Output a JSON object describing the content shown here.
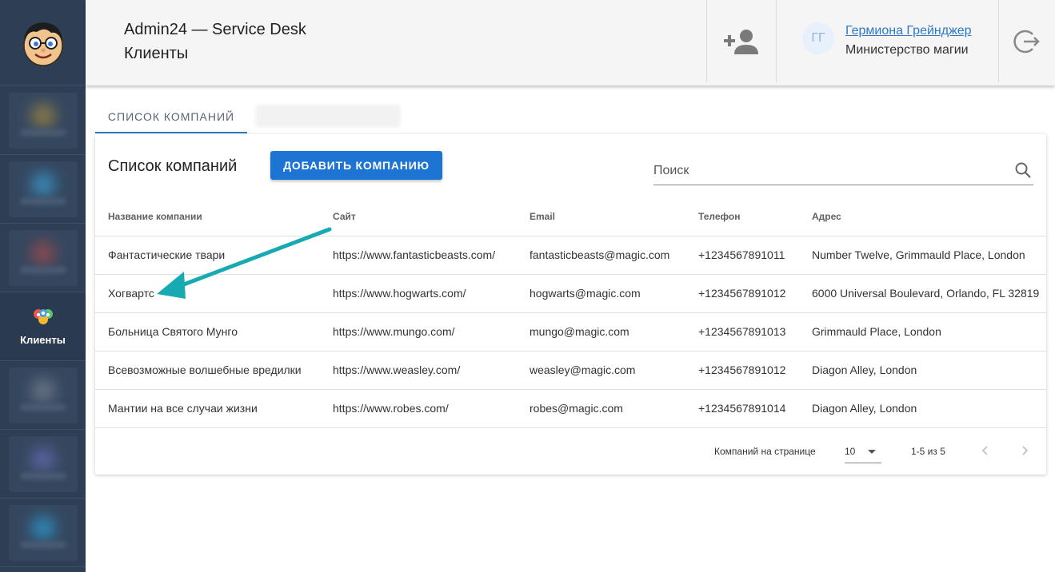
{
  "header": {
    "app_title": "Admin24 — Service Desk",
    "page_subtitle": "Клиенты",
    "user_initials": "ГГ",
    "user_name": "Гермиона Грейнджер",
    "user_org": "Министерство магии"
  },
  "sidebar": {
    "active_item_label": "Клиенты"
  },
  "tabs": [
    {
      "label": "СПИСОК КОМПАНИЙ"
    }
  ],
  "companies": {
    "title": "Список компаний",
    "add_button": "ДОБАВИТЬ КОМПАНИЮ",
    "search_placeholder": "Поиск",
    "columns": [
      "Название компании",
      "Сайт",
      "Email",
      "Телефон",
      "Адрес"
    ],
    "rows": [
      [
        "Фантастические твари",
        "https://www.fantasticbeasts.com/",
        "fantasticbeasts@magic.com",
        "+1234567891011",
        "Number Twelve, Grimmauld Place, London"
      ],
      [
        "Хогвартс",
        "https://www.hogwarts.com/",
        "hogwarts@magic.com",
        "+1234567891012",
        "6000 Universal Boulevard, Orlando, FL 32819"
      ],
      [
        "Больница Святого Мунго",
        "https://www.mungo.com/",
        "mungo@magic.com",
        "+1234567891013",
        "Grimmauld Place, London"
      ],
      [
        "Всевозможные волшебные вредилки",
        "https://www.weasley.com/",
        "weasley@magic.com",
        "+1234567891012",
        "Diagon Alley, London"
      ],
      [
        "Мантии на все случаи жизни",
        "https://www.robes.com/",
        "robes@magic.com",
        "+1234567891014",
        "Diagon Alley, London"
      ]
    ],
    "footer": {
      "rows_per_page_label": "Компаний на странице",
      "rows_per_page_value": "10",
      "range": "1-5 из 5"
    }
  },
  "colors": {
    "sidebar_bg": "#2e3e54",
    "accent": "#1e74d2",
    "link": "#2f78c6",
    "annotation_arrow": "#17aab3"
  },
  "icons": [
    "add-user-icon",
    "logout-icon",
    "search-icon",
    "chevron-left-icon",
    "chevron-right-icon",
    "dropdown-arrow-icon",
    "clients-icon"
  ]
}
